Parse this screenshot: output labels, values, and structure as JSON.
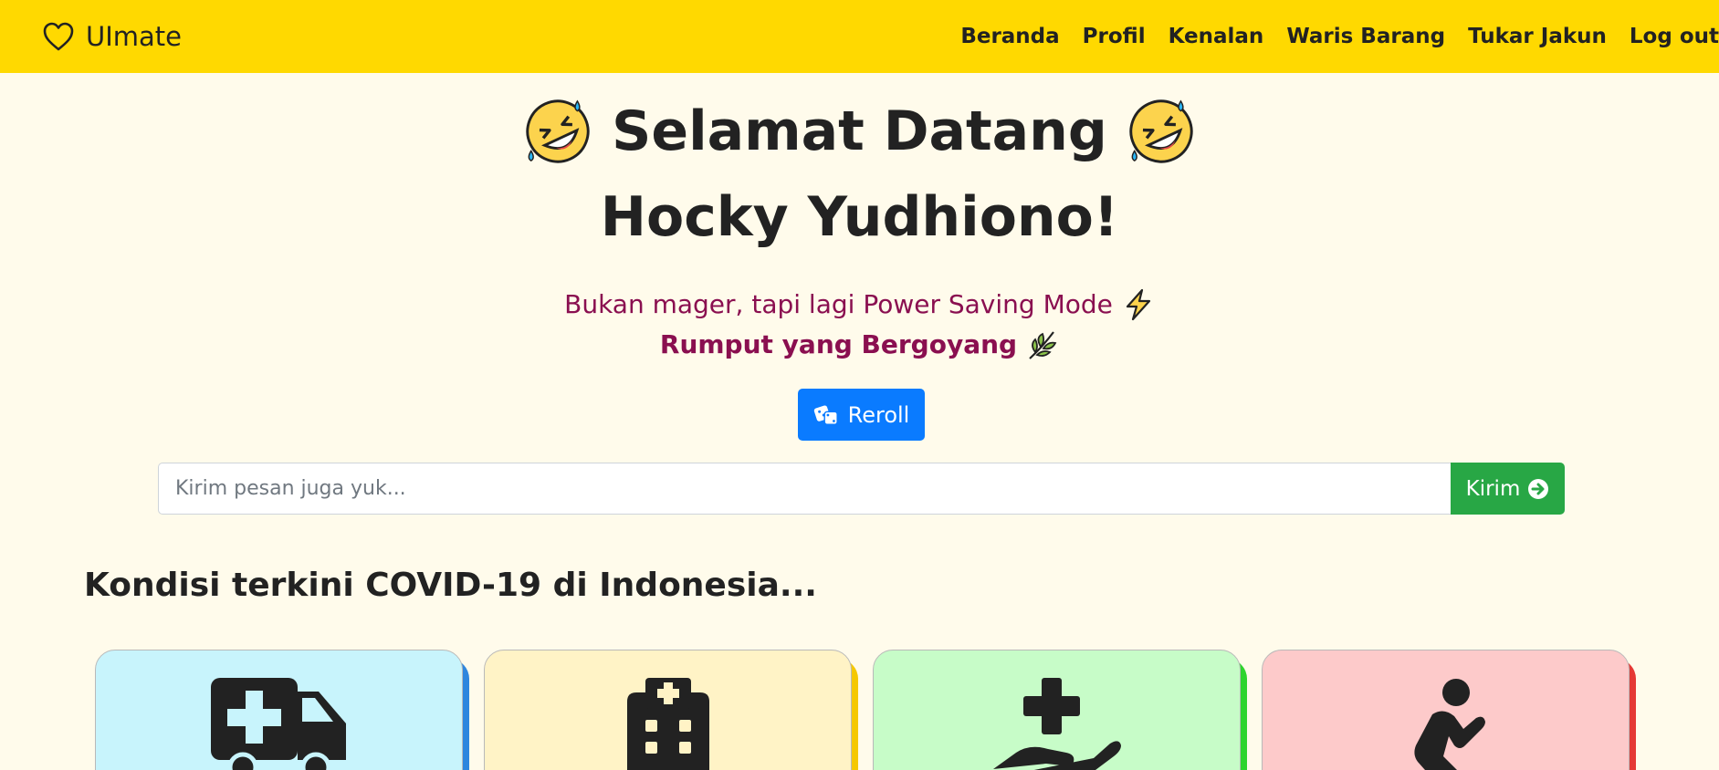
{
  "navbar": {
    "brand": "UImate",
    "links": [
      "Beranda",
      "Profil",
      "Kenalan",
      "Waris Barang",
      "Tukar Jakun",
      "Log out"
    ]
  },
  "hero": {
    "greeting": "Selamat Datang",
    "name": "Hocky Yudhiono!",
    "emoji": "rolling-on-floor-laughing"
  },
  "quote": {
    "text": "Bukan mager, tapi lagi Power Saving Mode",
    "text_emoji": "lightning",
    "author": "Rumput yang Bergoyang",
    "author_emoji": "herb"
  },
  "reroll": {
    "label": "Reroll",
    "icon": "dice-icon"
  },
  "message": {
    "placeholder": "Kirim pesan juga yuk...",
    "value": "",
    "send_label": "Kirim"
  },
  "covid": {
    "title": "Kondisi terkini COVID-19 di Indonesia...",
    "cards": [
      {
        "icon": "ambulance-icon",
        "bg": "#c8f4fc",
        "accent": "#2e86de"
      },
      {
        "icon": "hospital-icon",
        "bg": "#fff3c6",
        "accent": "#f5c800"
      },
      {
        "icon": "hand-medical-icon",
        "bg": "#c7fcc8",
        "accent": "#2ed42e"
      },
      {
        "icon": "praying-icon",
        "bg": "#fdcaca",
        "accent": "#e53935"
      }
    ]
  },
  "colors": {
    "navbar": "#ffd900",
    "background": "#fffbeb",
    "quote": "#8a0f50",
    "reroll": "#0a7bff",
    "send": "#28a745"
  }
}
